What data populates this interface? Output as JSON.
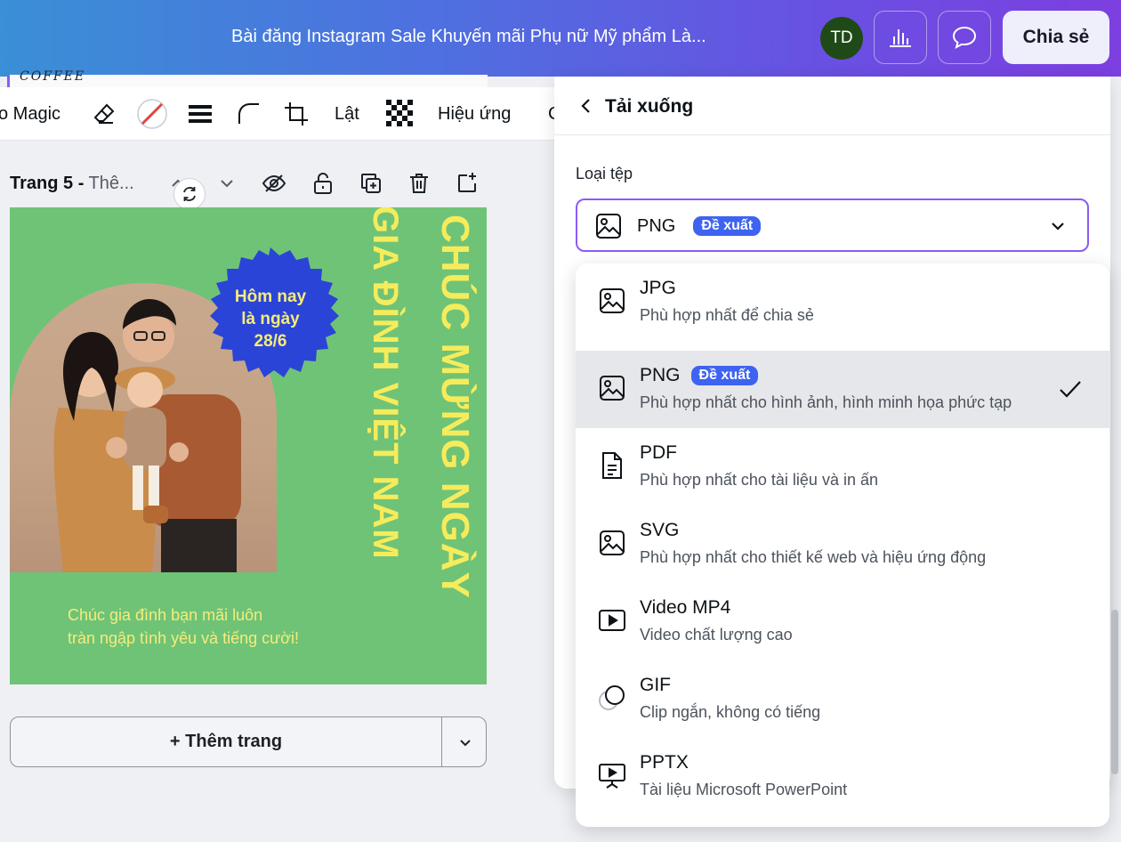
{
  "header": {
    "doc_title": "Bài đăng Instagram Sale Khuyến mãi Phụ nữ Mỹ phẩm Là...",
    "avatar_initials": "TD",
    "share_label": "Chia sẻ",
    "accent_gradient": [
      "#3a8fd6",
      "#7d3fe0"
    ]
  },
  "toolbar": {
    "magic_label": "o Magic",
    "flip_label": "Lật",
    "effects_label": "Hiệu ứng",
    "overflow_label": "C",
    "icons": [
      "eraser-icon",
      "color-none-icon",
      "border-weight-icon",
      "corner-rounding-icon",
      "crop-icon",
      "transparency-icon"
    ]
  },
  "canvas_bg_text": "COFFEE",
  "page": {
    "label_bold": "Trang 5 -",
    "label_muted": " Thê...",
    "icons": [
      "chevron-up-icon",
      "chevron-down-icon",
      "eye-icon",
      "lock-icon",
      "duplicate-icon",
      "trash-icon",
      "add-page-icon"
    ]
  },
  "design": {
    "badge_lines": [
      "Hôm nay",
      "là ngày",
      "28/6"
    ],
    "vertical_line_1": "CHÚC MỪNG NGÀY",
    "vertical_line_2": "GIA ĐÌNH VIỆT NAM",
    "wish_lines": [
      "Chúc gia đình bạn mãi luôn",
      "tràn ngập tình yêu và tiếng cười!"
    ],
    "colors": {
      "background": "#6fc377",
      "badge": "#2b44d8",
      "text": "#f5ec5c"
    }
  },
  "add_page": {
    "label": "+ Thêm trang"
  },
  "download": {
    "title": "Tải xuống",
    "file_type_label": "Loại tệp",
    "selected": {
      "format": "PNG",
      "badge": "Đề xuất"
    },
    "options": [
      {
        "title": "JPG",
        "desc": "Phù hợp nhất để chia sẻ",
        "icon": "image-icon",
        "badge": "",
        "selected": false
      },
      {
        "title": "PNG",
        "desc": "Phù hợp nhất cho hình ảnh, hình minh họa phức tạp",
        "icon": "image-icon",
        "badge": "Đề xuất",
        "selected": true
      },
      {
        "title": "PDF",
        "desc": "Phù hợp nhất cho tài liệu và in ấn",
        "icon": "document-icon",
        "badge": "",
        "selected": false
      },
      {
        "title": "SVG",
        "desc": "Phù hợp nhất cho thiết kế web và hiệu ứng động",
        "icon": "image-icon",
        "badge": "",
        "selected": false
      },
      {
        "title": "Video MP4",
        "desc": "Video chất lượng cao",
        "icon": "video-icon",
        "badge": "",
        "selected": false
      },
      {
        "title": "GIF",
        "desc": "Clip ngắn, không có tiếng",
        "icon": "gif-icon",
        "badge": "",
        "selected": false
      },
      {
        "title": "PPTX",
        "desc": "Tài liệu Microsoft PowerPoint",
        "icon": "presentation-icon",
        "badge": "",
        "selected": false
      }
    ]
  }
}
